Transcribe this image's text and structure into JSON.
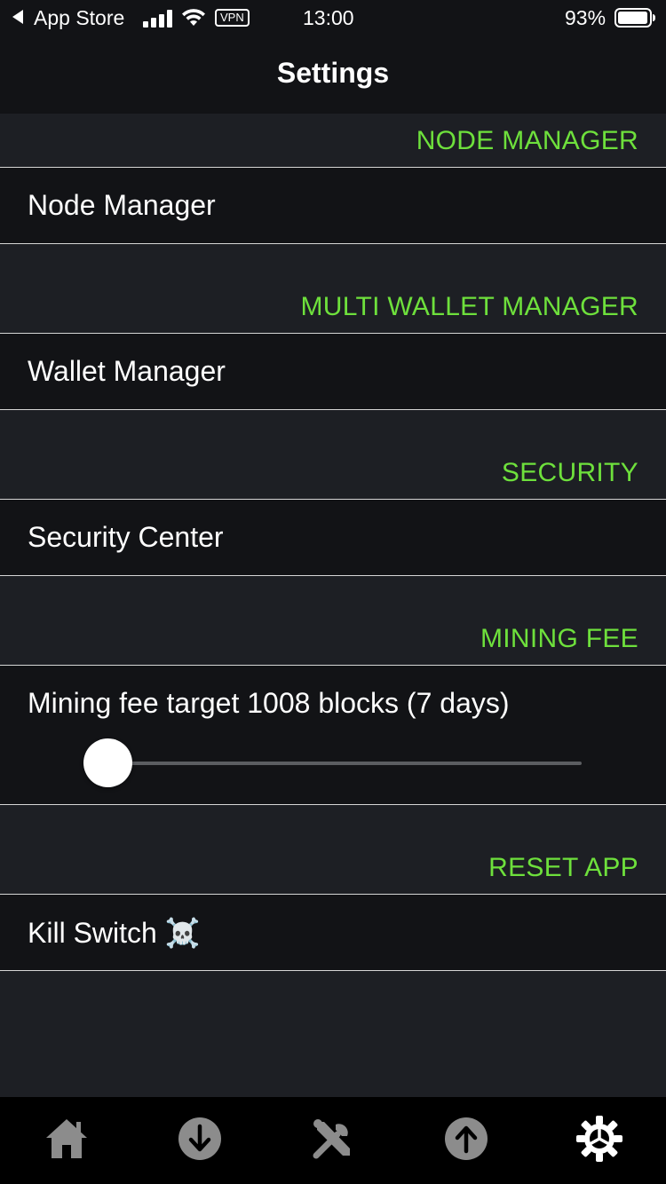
{
  "status_bar": {
    "back_app": "App Store",
    "vpn": "VPN",
    "time": "13:00",
    "battery": "93%"
  },
  "nav": {
    "title": "Settings"
  },
  "sections": {
    "node_manager": {
      "header": "NODE MANAGER",
      "row": "Node Manager"
    },
    "multi_wallet": {
      "header": "MULTI WALLET MANAGER",
      "row": "Wallet Manager"
    },
    "security": {
      "header": "SECURITY",
      "row": "Security Center"
    },
    "mining_fee": {
      "header": "MINING FEE",
      "row": "Mining fee target 1008 blocks (7 days)",
      "slider_value": 0
    },
    "reset_app": {
      "header": "RESET APP",
      "row": "Kill Switch ☠️"
    }
  },
  "tabbar": {
    "tabs": [
      {
        "icon": "home-icon"
      },
      {
        "icon": "receive-icon"
      },
      {
        "icon": "tools-icon"
      },
      {
        "icon": "send-icon"
      },
      {
        "icon": "settings-gear-icon",
        "selected": true
      }
    ]
  },
  "colors": {
    "accent_green": "#6ee03c",
    "background": "#1d1f24",
    "row_background": "#121316"
  }
}
